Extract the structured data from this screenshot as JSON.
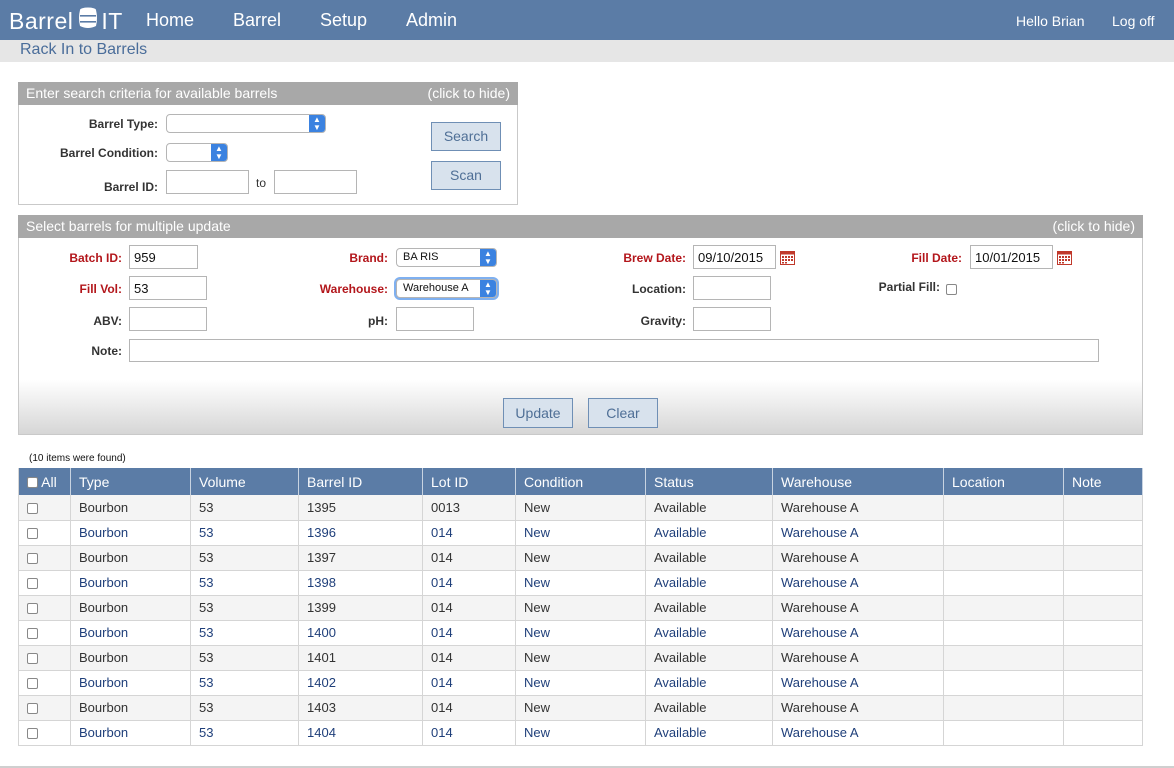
{
  "app": {
    "logo_left": "Barrel",
    "logo_right": "IT",
    "nav": [
      "Home",
      "Barrel",
      "Setup",
      "Admin"
    ],
    "hello": "Hello  Brian",
    "logoff": "Log off",
    "page_title": "Rack In to Barrels"
  },
  "search_panel": {
    "title": "Enter search criteria for available barrels",
    "hide": "(click to hide)",
    "barrel_type_label": "Barrel Type:",
    "barrel_type_value": "",
    "barrel_condition_label": "Barrel Condition:",
    "barrel_condition_value": "",
    "barrel_id_label": "Barrel ID:",
    "barrel_id_from": "",
    "barrel_id_to": "",
    "to_label": "to",
    "search_button": "Search",
    "scan_button": "Scan"
  },
  "update_panel": {
    "title": "Select barrels for multiple update",
    "hide": "(click to hide)",
    "batch_id_label": "Batch ID:",
    "batch_id": "959",
    "brand_label": "Brand:",
    "brand": "BA RIS",
    "brew_date_label": "Brew Date:",
    "brew_date": "09/10/2015",
    "fill_date_label": "Fill Date:",
    "fill_date": "10/01/2015",
    "fill_vol_label": "Fill Vol:",
    "fill_vol": "53",
    "warehouse_label": "Warehouse:",
    "warehouse": "Warehouse A",
    "location_label": "Location:",
    "location": "",
    "partial_fill_label": "Partial Fill:",
    "abv_label": "ABV:",
    "abv": "",
    "ph_label": "pH:",
    "ph": "",
    "gravity_label": "Gravity:",
    "gravity": "",
    "note_label": "Note:",
    "note": "",
    "update_button": "Update",
    "clear_button": "Clear"
  },
  "results": {
    "found_text": "(10 items were found)",
    "all_label": "All",
    "columns": [
      "Type",
      "Volume",
      "Barrel ID",
      "Lot ID",
      "Condition",
      "Status",
      "Warehouse",
      "Location",
      "Note"
    ],
    "rows": [
      {
        "type": "Bourbon",
        "volume": "53",
        "barrel_id": "1395",
        "lot_id": "0013",
        "condition": "New",
        "status": "Available",
        "warehouse": "Warehouse A",
        "location": "",
        "note": ""
      },
      {
        "type": "Bourbon",
        "volume": "53",
        "barrel_id": "1396",
        "lot_id": "014",
        "condition": "New",
        "status": "Available",
        "warehouse": "Warehouse A",
        "location": "",
        "note": ""
      },
      {
        "type": "Bourbon",
        "volume": "53",
        "barrel_id": "1397",
        "lot_id": "014",
        "condition": "New",
        "status": "Available",
        "warehouse": "Warehouse A",
        "location": "",
        "note": ""
      },
      {
        "type": "Bourbon",
        "volume": "53",
        "barrel_id": "1398",
        "lot_id": "014",
        "condition": "New",
        "status": "Available",
        "warehouse": "Warehouse A",
        "location": "",
        "note": ""
      },
      {
        "type": "Bourbon",
        "volume": "53",
        "barrel_id": "1399",
        "lot_id": "014",
        "condition": "New",
        "status": "Available",
        "warehouse": "Warehouse A",
        "location": "",
        "note": ""
      },
      {
        "type": "Bourbon",
        "volume": "53",
        "barrel_id": "1400",
        "lot_id": "014",
        "condition": "New",
        "status": "Available",
        "warehouse": "Warehouse A",
        "location": "",
        "note": ""
      },
      {
        "type": "Bourbon",
        "volume": "53",
        "barrel_id": "1401",
        "lot_id": "014",
        "condition": "New",
        "status": "Available",
        "warehouse": "Warehouse A",
        "location": "",
        "note": ""
      },
      {
        "type": "Bourbon",
        "volume": "53",
        "barrel_id": "1402",
        "lot_id": "014",
        "condition": "New",
        "status": "Available",
        "warehouse": "Warehouse A",
        "location": "",
        "note": ""
      },
      {
        "type": "Bourbon",
        "volume": "53",
        "barrel_id": "1403",
        "lot_id": "014",
        "condition": "New",
        "status": "Available",
        "warehouse": "Warehouse A",
        "location": "",
        "note": ""
      },
      {
        "type": "Bourbon",
        "volume": "53",
        "barrel_id": "1404",
        "lot_id": "014",
        "condition": "New",
        "status": "Available",
        "warehouse": "Warehouse A",
        "location": "",
        "note": ""
      }
    ]
  },
  "colors": {
    "nav_bg": "#5b7ca6",
    "required_label": "#b3161b",
    "panel_header": "#a8a8a8"
  }
}
